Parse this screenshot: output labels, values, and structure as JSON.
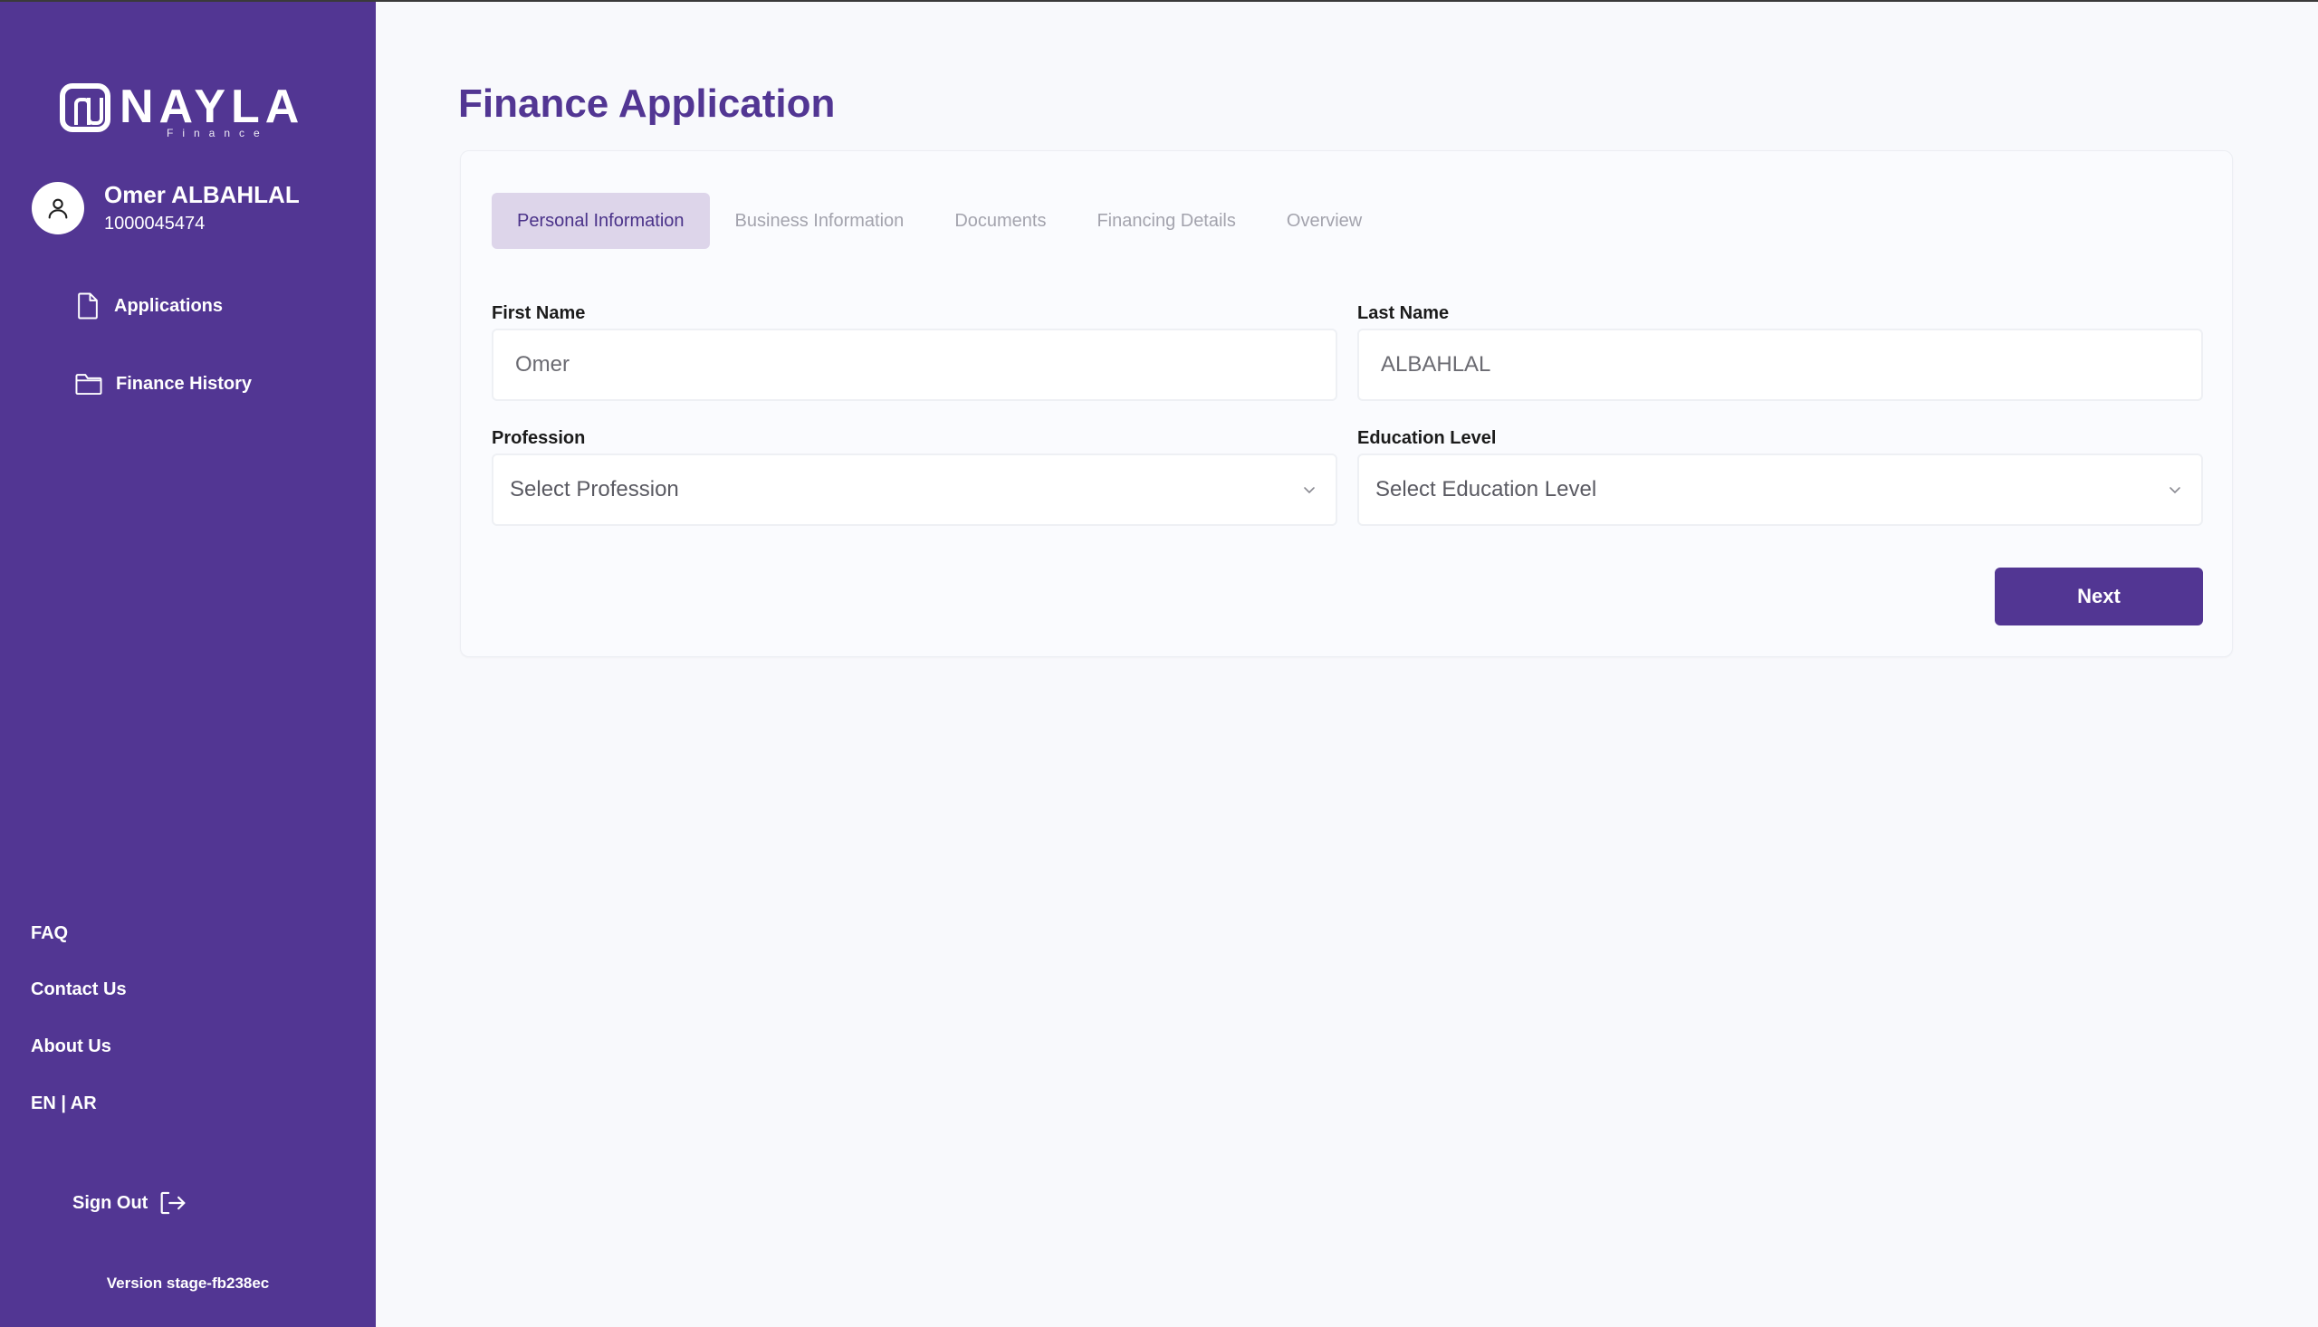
{
  "brand": {
    "name": "NAYLA",
    "tagline": "Finance"
  },
  "user": {
    "name": "Omer ALBAHLAL",
    "id": "1000045474"
  },
  "nav": [
    {
      "label": "Applications",
      "icon": "file-icon"
    },
    {
      "label": "Finance History",
      "icon": "folder-icon"
    }
  ],
  "footer": {
    "faq": "FAQ",
    "contact": "Contact Us",
    "about": "About Us",
    "lang_en": "EN",
    "lang_sep": "|",
    "lang_ar": "AR",
    "signout": "Sign Out",
    "version": "Version stage-fb238ec"
  },
  "page": {
    "title": "Finance Application"
  },
  "tabs": [
    {
      "label": "Personal Information",
      "active": true
    },
    {
      "label": "Business Information",
      "active": false
    },
    {
      "label": "Documents",
      "active": false
    },
    {
      "label": "Financing Details",
      "active": false
    },
    {
      "label": "Overview",
      "active": false
    }
  ],
  "form": {
    "first_name": {
      "label": "First Name",
      "value": "Omer"
    },
    "last_name": {
      "label": "Last Name",
      "value": "ALBAHLAL"
    },
    "profession": {
      "label": "Profession",
      "placeholder": "Select Profession"
    },
    "education": {
      "label": "Education Level",
      "placeholder": "Select Education Level"
    },
    "next_label": "Next"
  },
  "colors": {
    "sidebar": "#523693",
    "accent": "#523693",
    "active_tab_bg": "#ddd5ea",
    "background": "#f8f9fc"
  }
}
